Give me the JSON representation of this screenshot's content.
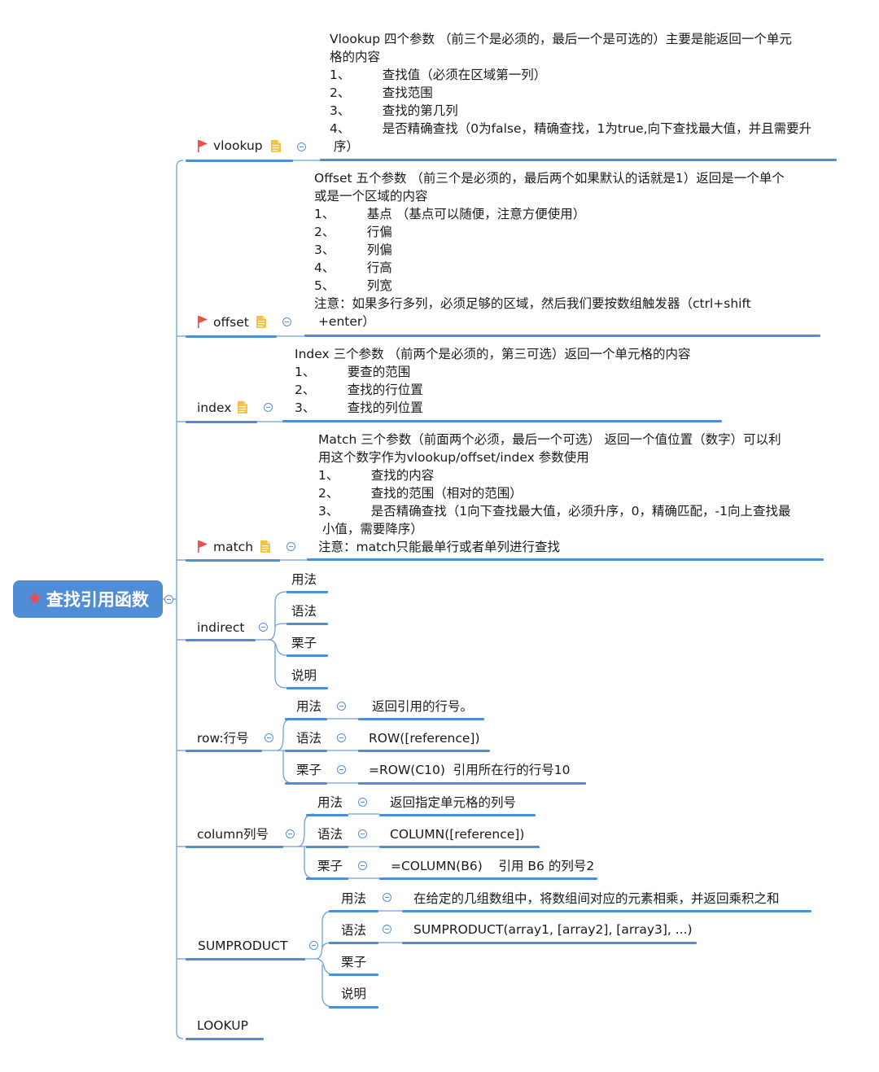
{
  "root": {
    "label": "查找引用函数",
    "icon": "star-icon"
  },
  "colors": {
    "accent": "#4f8dd6",
    "flag": "#ef4b4b",
    "note": "#f5c342",
    "root_text": "#ffffff"
  },
  "branches": {
    "vlookup": {
      "label": "vlookup",
      "note_lines": [
        "Vlookup  四个参数  （前三个是必须的，最后一个是可选的）主要是能返回一个单元",
        "格的内容",
        "1、        查找值（必须在区域第一列）",
        "2、        查找范围",
        "3、        查找的第几列",
        "4、        是否精确查找（0为false，精确查找，1为true,向下查找最大值，并且需要升",
        " 序）"
      ]
    },
    "offset": {
      "label": "offset",
      "note_lines": [
        "Offset 五个参数 （前三个是必须的，最后两个如果默认的话就是1）返回是一个单个",
        "或是一个区域的内容",
        "1、        基点 （基点可以随便，注意方便使用）",
        "2、        行偏",
        "3、        列偏",
        "4、        行高",
        "5、        列宽",
        "注意：如果多行多列，必须足够的区域，然后我们要按数组触发器（ctrl+shift",
        " +enter）"
      ]
    },
    "index": {
      "label": "index",
      "note_lines": [
        "Index 三个参数 （前两个是必须的，第三可选）返回一个单元格的内容",
        "1、        要查的范围",
        "2、        查找的行位置",
        "3、        查找的列位置"
      ]
    },
    "match": {
      "label": "match",
      "note_lines": [
        "Match 三个参数（前面两个必须，最后一个可选） 返回一个值位置（数字）可以利",
        "用这个数字作为vlookup/offset/index 参数使用",
        "1、        查找的内容",
        "2、        查找的范围（相对的范围）",
        "3、        是否精确查找（1向下查找最大值，必须升序，0，精确匹配，-1向上查找最",
        " 小值，需要降序）",
        "注意：match只能最单行或者单列进行查找"
      ]
    },
    "indirect": {
      "label": "indirect",
      "children": [
        "用法",
        "语法",
        "栗子",
        "说明"
      ]
    },
    "row": {
      "label": "row:行号",
      "children": [
        {
          "label": "用法",
          "value": "返回引用的行号。"
        },
        {
          "label": "语法",
          "value": "ROW([reference])"
        },
        {
          "label": "栗子",
          "value": "=ROW(C10)  引用所在行的行号10"
        }
      ]
    },
    "column": {
      "label": "column列号",
      "children": [
        {
          "label": "用法",
          "value": "返回指定单元格的列号"
        },
        {
          "label": "语法",
          "value": "COLUMN([reference])"
        },
        {
          "label": "栗子",
          "value": "=COLUMN(B6)    引用 B6 的列号2"
        }
      ]
    },
    "sumproduct": {
      "label": "SUMPRODUCT",
      "children": [
        {
          "label": "用法",
          "value": "在给定的几组数组中，将数组间对应的元素相乘，并返回乘积之和"
        },
        {
          "label": "语法",
          "value": "SUMPRODUCT(array1, [array2], [array3], ...)"
        },
        {
          "label": "栗子",
          "value": ""
        },
        {
          "label": "说明",
          "value": ""
        }
      ]
    },
    "lookup": {
      "label": "LOOKUP"
    }
  }
}
